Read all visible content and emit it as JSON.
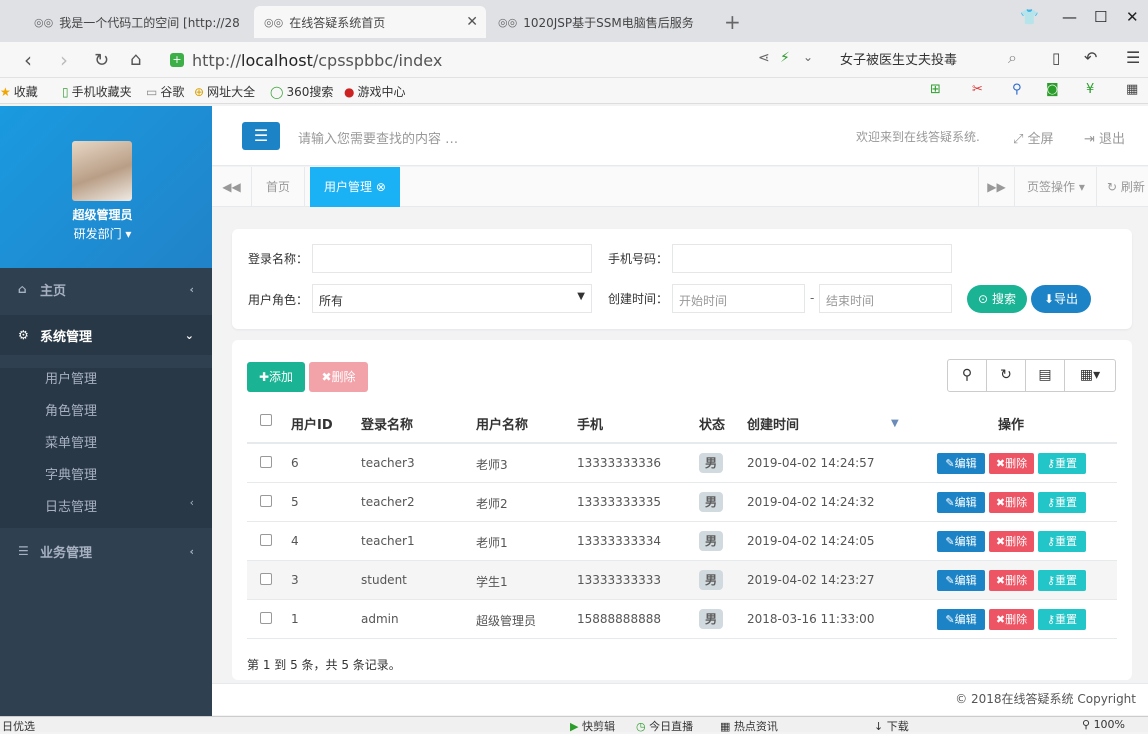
{
  "browser": {
    "tabs": [
      {
        "label": "我是一个代码工的空间 [http://28"
      },
      {
        "label": "在线答疑系统首页"
      },
      {
        "label": "1020JSP基于SSM电脑售后服务"
      }
    ],
    "url_prefix": "http://",
    "url_host": "localhost",
    "url_path": "/cpsspbbc/index",
    "search_suggest": "女子被医生丈夫投毒",
    "bookmarks": [
      "收藏",
      "手机收藏夹",
      "谷歌",
      "网址大全",
      "360搜索",
      "游戏中心"
    ]
  },
  "sidebar": {
    "user_name": "超级管理员",
    "department": "研发部门",
    "menu": [
      {
        "label": "主页"
      },
      {
        "label": "系统管理"
      },
      {
        "label": "业务管理"
      }
    ],
    "submenu": [
      "用户管理",
      "角色管理",
      "菜单管理",
      "字典管理",
      "日志管理"
    ]
  },
  "header": {
    "search_placeholder": "请输入您需要查找的内容 …",
    "welcome": "欢迎来到在线答疑系统.",
    "fullscreen": "全屏",
    "logout": "退出"
  },
  "page_tabs": {
    "home": "首页",
    "current": "用户管理",
    "tab_ops": "页签操作",
    "refresh": "刷新"
  },
  "search_form": {
    "login_name_label": "登录名称：",
    "phone_label": "手机号码：",
    "role_label": "用户角色：",
    "role_value": "所有",
    "created_label": "创建时间：",
    "start_placeholder": "开始时间",
    "end_placeholder": "结束时间",
    "search_btn": "搜索",
    "export_btn": "导出"
  },
  "toolbar": {
    "add": "添加",
    "delete": "删除"
  },
  "table": {
    "headers": [
      "用户ID",
      "登录名称",
      "用户名称",
      "手机",
      "状态",
      "创建时间",
      "操作"
    ],
    "rows": [
      {
        "id": "6",
        "login": "teacher3",
        "name": "老师3",
        "phone": "13333333336",
        "status": "男",
        "created": "2019-04-02 14:24:57"
      },
      {
        "id": "5",
        "login": "teacher2",
        "name": "老师2",
        "phone": "13333333335",
        "status": "男",
        "created": "2019-04-02 14:24:32"
      },
      {
        "id": "4",
        "login": "teacher1",
        "name": "老师1",
        "phone": "13333333334",
        "status": "男",
        "created": "2019-04-02 14:24:05"
      },
      {
        "id": "3",
        "login": "student",
        "name": "学生1",
        "phone": "13333333333",
        "status": "男",
        "created": "2019-04-02 14:23:27"
      },
      {
        "id": "1",
        "login": "admin",
        "name": "超级管理员",
        "phone": "15888888888",
        "status": "男",
        "created": "2018-03-16 11:33:00"
      }
    ],
    "actions": {
      "edit": "编辑",
      "delete": "删除",
      "reset": "重置"
    },
    "summary": "第 1 到 5 条，共 5 条记录。"
  },
  "footer": {
    "copyright": "© 2018在线答疑系统 Copyright"
  },
  "statusbar": {
    "left": "日优选",
    "items": [
      "快剪辑",
      "今日直播",
      "热点资讯",
      "下载",
      "100%"
    ]
  },
  "colors": {
    "primary": "#1c84c6",
    "success": "#1ab394",
    "danger": "#ed5565",
    "info": "#23c6c8",
    "sidebar": "#2f4050",
    "tab_active": "#1ab1f5"
  }
}
